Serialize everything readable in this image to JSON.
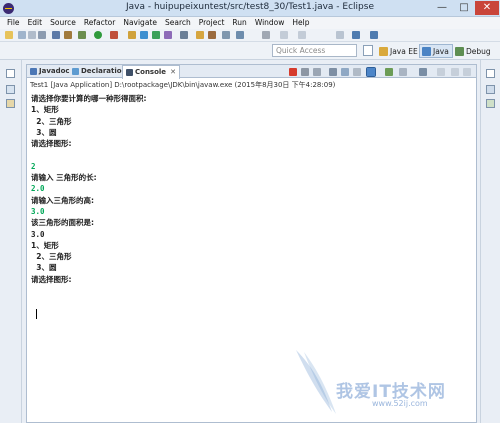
{
  "window": {
    "title": "Java - huipupeixuntest/src/test8_30/Test1.java - Eclipse",
    "minimize": "—",
    "maximize": "□",
    "close": "✕"
  },
  "menu": [
    "File",
    "Edit",
    "Source",
    "Refactor",
    "Navigate",
    "Search",
    "Project",
    "Run",
    "Window",
    "Help"
  ],
  "perspective_bar": {
    "quick_access_placeholder": "Quick Access",
    "perspectives": [
      "Java EE",
      "Java",
      "Debug"
    ],
    "active": "Java"
  },
  "tabs": [
    {
      "label": "Javadoc",
      "icon": "javadoc-icon"
    },
    {
      "label": "Declaration",
      "icon": "declaration-icon"
    },
    {
      "label": "Console",
      "icon": "console-icon",
      "active": true,
      "close": "✕"
    }
  ],
  "console": {
    "header": "Test1 [Java Application] D:\\rootpackage\\JDK\\bin\\javaw.exe (2015年8月30日 下午4:28:09)",
    "lines": [
      {
        "text": "请选择你要计算的哪一种形得面积:",
        "type": "output"
      },
      {
        "text": "1、矩形",
        "type": "output"
      },
      {
        "text": "  2、三角形",
        "type": "output"
      },
      {
        "text": "  3、圆",
        "type": "output"
      },
      {
        "text": "请选择图形:",
        "type": "output"
      },
      {
        "text": "",
        "type": "output"
      },
      {
        "text": "2",
        "type": "input"
      },
      {
        "text": "请输入 三角形的长:",
        "type": "output"
      },
      {
        "text": "2.0",
        "type": "input"
      },
      {
        "text": "请输入三角形的高:",
        "type": "output"
      },
      {
        "text": "3.0",
        "type": "input"
      },
      {
        "text": "该三角形的面积是:",
        "type": "output"
      },
      {
        "text": "3.0",
        "type": "num"
      },
      {
        "text": "1、矩形",
        "type": "output"
      },
      {
        "text": "  2、三角形",
        "type": "output"
      },
      {
        "text": "  3、圆",
        "type": "output"
      },
      {
        "text": "请选择图形:",
        "type": "output"
      }
    ]
  },
  "watermark": {
    "text": "我爱IT技术网",
    "url": "www.52ij.com"
  },
  "colors": {
    "input_text": "#00a858",
    "title_bar": "#cfe0f2",
    "close_button": "#c9453a"
  }
}
